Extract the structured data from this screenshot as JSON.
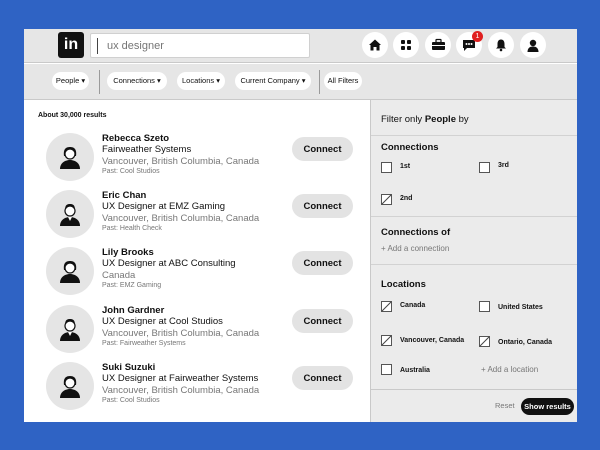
{
  "header": {
    "logo_text": "in",
    "search_placeholder": "ux designer",
    "icons": [
      "home-icon",
      "network-icon",
      "jobs-briefcase-icon",
      "messaging-icon",
      "notifications-bell-icon",
      "profile-avatar-icon"
    ],
    "message_badge": "1",
    "badge_color": "#e02020"
  },
  "filters": {
    "people": "People ▾",
    "connections": "Connections ▾",
    "locations": "Locations ▾",
    "current_company": "Current Company ▾",
    "all_filters": "All Filters"
  },
  "results": {
    "count": "About 30,000 results",
    "connect_label": "Connect",
    "people": [
      {
        "name": "Rebecca Szeto",
        "title": "Fairweather Systems",
        "location": "Vancouver, British Columbia, Canada",
        "past": "Past: Cool Studios",
        "gender": "female"
      },
      {
        "name": "Eric Chan",
        "title": "UX Designer at EMZ Gaming",
        "location": "Vancouver, British Columbia, Canada",
        "past": "Past: Health Check",
        "gender": "male"
      },
      {
        "name": "Lily Brooks",
        "title": "UX Designer at ABC Consulting",
        "location": "Canada",
        "past": "Past: EMZ Gaming",
        "gender": "female"
      },
      {
        "name": "John Gardner",
        "title": "UX Designer at Cool Studios",
        "location": "Vancouver, British Columbia, Canada",
        "past": "Past: Fairweather Systems",
        "gender": "male"
      },
      {
        "name": "Suki Suzuki",
        "title": "UX Designer at Fairweather Systems",
        "location": "Vancouver, British Columbia, Canada",
        "past": "Past: Cool Studios",
        "gender": "female"
      }
    ]
  },
  "panel": {
    "title_pre": "Filter only",
    "title_bold": "People",
    "title_post": "by",
    "connections": {
      "heading": "Connections",
      "options": [
        {
          "label": "1st",
          "checked": false
        },
        {
          "label": "3rd",
          "checked": false
        },
        {
          "label": "2nd",
          "checked": true
        }
      ]
    },
    "connections_of": {
      "heading": "Connections of",
      "add": "+ Add a connection"
    },
    "locations": {
      "heading": "Locations",
      "options": [
        {
          "label": "Canada",
          "checked": true
        },
        {
          "label": "United States",
          "checked": false
        },
        {
          "label": "Vancouver, Canada",
          "checked": true
        },
        {
          "label": "Ontario, Canada",
          "checked": true
        },
        {
          "label": "Australia",
          "checked": false
        }
      ],
      "add": "+ Add a location"
    },
    "reset": "Reset",
    "show": "Show results"
  }
}
